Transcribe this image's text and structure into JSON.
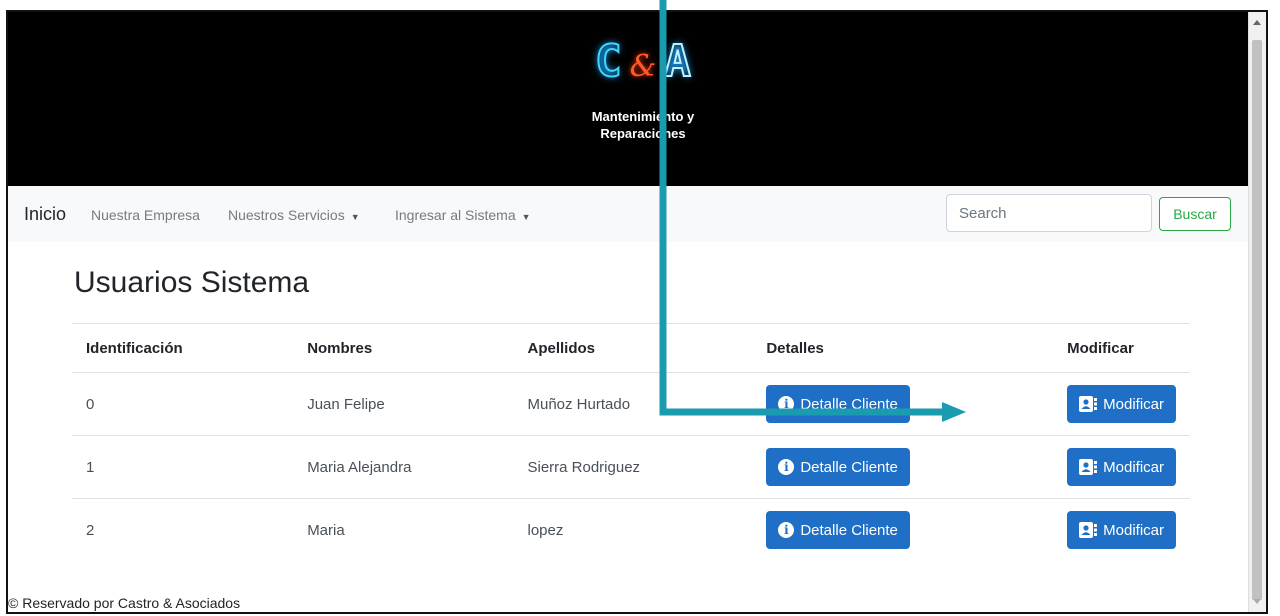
{
  "banner": {
    "logo_left": "C",
    "logo_amp": "&",
    "logo_right": "A",
    "tagline_line1": "Mantenimiento y",
    "tagline_line2": "Reparaciones"
  },
  "navbar": {
    "brand": "Inicio",
    "links": [
      "Nuestra Empresa",
      "Nuestros Servicios",
      "Ingresar al Sistema"
    ],
    "search_placeholder": "Search",
    "search_button": "Buscar"
  },
  "page": {
    "title": "Usuarios Sistema",
    "columns": [
      "Identificación",
      "Nombres",
      "Apellidos",
      "Detalles",
      "Modificar"
    ],
    "rows": [
      {
        "id": "0",
        "nombres": "Juan Felipe",
        "apellidos": "Muñoz Hurtado",
        "detalle": "Detalle Cliente",
        "modificar": "Modificar"
      },
      {
        "id": "1",
        "nombres": "Maria Alejandra",
        "apellidos": "Sierra Rodriguez",
        "detalle": "Detalle Cliente",
        "modificar": "Modificar"
      },
      {
        "id": "2",
        "nombres": "Maria",
        "apellidos": "lopez",
        "detalle": "Detalle Cliente",
        "modificar": "Modificar"
      }
    ]
  },
  "footer": {
    "text": "© Reservado por Castro & Asociados"
  },
  "colors": {
    "primary_button": "#1f6fc6",
    "search_button": "#28a745",
    "annotation_arrow": "#1a9bb0"
  },
  "icons": {
    "info": "info-circle-icon",
    "modify": "user-card-icon",
    "caret": "caret-down-icon"
  }
}
